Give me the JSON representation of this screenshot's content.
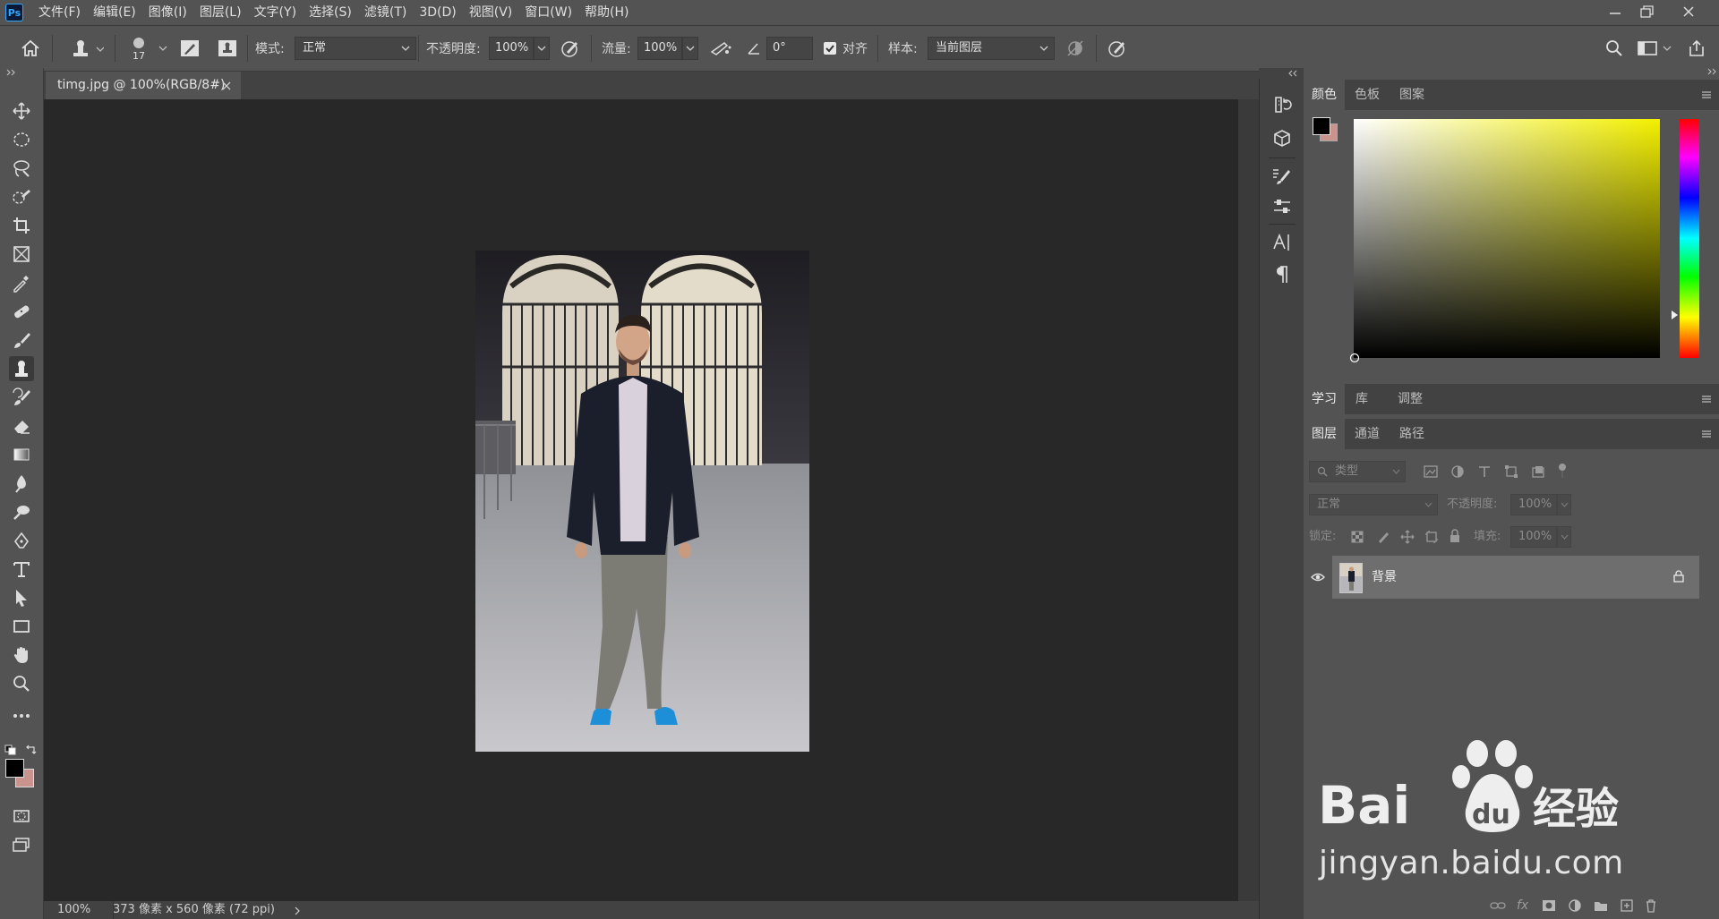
{
  "app": {
    "logo_text": "Ps"
  },
  "menu": [
    "文件(F)",
    "编辑(E)",
    "图像(I)",
    "图层(L)",
    "文字(Y)",
    "选择(S)",
    "滤镜(T)",
    "3D(D)",
    "视图(V)",
    "窗口(W)",
    "帮助(H)"
  ],
  "options": {
    "brush_size": "17",
    "mode_label": "模式:",
    "mode_value": "正常",
    "opacity_label": "不透明度:",
    "opacity_value": "100%",
    "flow_label": "流量:",
    "flow_value": "100%",
    "angle_value": "0°",
    "aligned_label": "对齐",
    "aligned_checked": true,
    "sample_label": "样本:",
    "sample_value": "当前图层"
  },
  "toolbar_tools": [
    "move-tool",
    "marquee-tool",
    "lasso-tool",
    "quick-select-tool",
    "crop-tool",
    "frame-tool",
    "eyedropper-tool",
    "healing-brush-tool",
    "brush-tool",
    "clone-stamp-tool",
    "history-brush-tool",
    "eraser-tool",
    "gradient-tool",
    "blur-tool",
    "dodge-tool",
    "pen-tool",
    "type-tool",
    "path-select-tool",
    "rectangle-tool",
    "hand-tool",
    "zoom-tool",
    "more-tools"
  ],
  "active_tool": "clone-stamp-tool",
  "document": {
    "tab_title": "timg.jpg @ 100%(RGB/8#)",
    "zoom": "100%",
    "info": "373 像素 x 560 像素 (72 ppi)"
  },
  "color_panel": {
    "tabs": [
      "颜色",
      "色板",
      "图案"
    ],
    "foreground": "#000000",
    "background": "#c9948e",
    "hue_base": "#f3f000"
  },
  "learn_panel": {
    "tabs": [
      "学习",
      "库",
      "调整"
    ]
  },
  "layers_panel": {
    "tabs": [
      "图层",
      "通道",
      "路径"
    ],
    "filter_placeholder": "类型",
    "blend_mode": "正常",
    "opacity_label": "不透明度:",
    "opacity_value": "100%",
    "lock_label": "锁定:",
    "fill_label": "填充:",
    "fill_value": "100%",
    "layers": [
      {
        "name": "背景",
        "visible": true,
        "locked": true
      }
    ]
  },
  "watermark": {
    "brand": "Bai du 经验",
    "url": "jingyan.baidu.com"
  }
}
